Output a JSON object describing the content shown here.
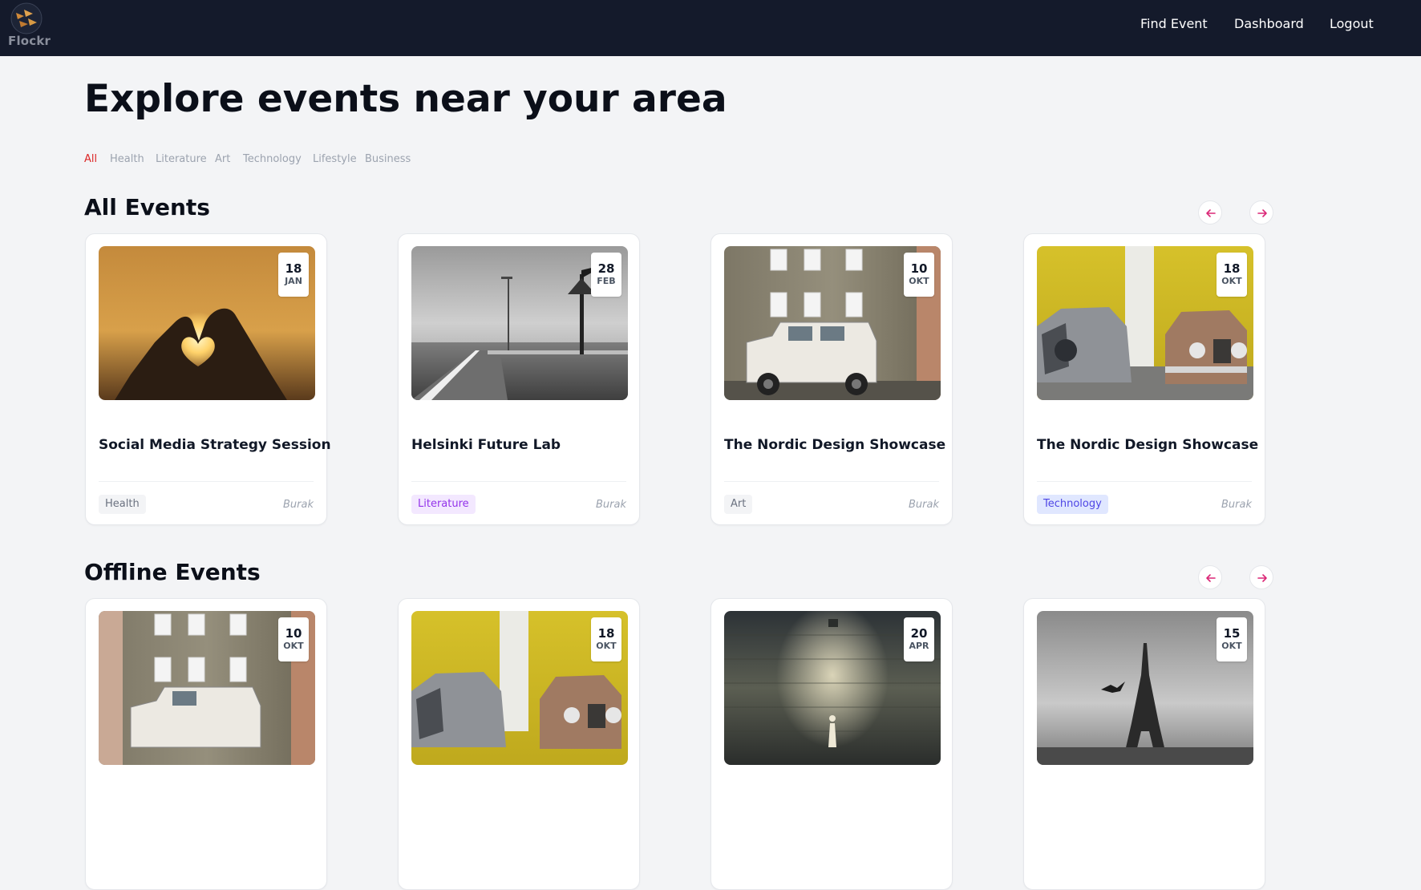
{
  "brand": {
    "name": "Flockr"
  },
  "nav": {
    "find_event": "Find Event",
    "dashboard": "Dashboard",
    "logout": "Logout"
  },
  "page_title": "Explore events near your area",
  "filters": [
    {
      "label": "All",
      "active": true
    },
    {
      "label": "Health"
    },
    {
      "label": "Literature"
    },
    {
      "label": "Art"
    },
    {
      "label": "Technology"
    },
    {
      "label": "Lifestyle"
    },
    {
      "label": "Business"
    }
  ],
  "sections": [
    {
      "title": "All Events",
      "cards": [
        {
          "day": "18",
          "month": "JAN",
          "title": "Social Media Strategy Session",
          "tag": "Health",
          "author": "Burak"
        },
        {
          "day": "28",
          "month": "FEB",
          "title": "Helsinki Future Lab",
          "tag": "Literature",
          "author": "Burak"
        },
        {
          "day": "10",
          "month": "OKT",
          "title": "The Nordic Design Showcase",
          "tag": "Art",
          "author": "Burak"
        },
        {
          "day": "18",
          "month": "OKT",
          "title": "The Nordic Design Showcase",
          "tag": "Technology",
          "author": "Burak"
        }
      ]
    },
    {
      "title": "Offline Events",
      "cards": [
        {
          "day": "10",
          "month": "OKT"
        },
        {
          "day": "18",
          "month": "OKT"
        },
        {
          "day": "20",
          "month": "APR"
        },
        {
          "day": "15",
          "month": "OKT"
        }
      ]
    }
  ],
  "tag_colors": {
    "Health": {
      "bg": "#f3f4f6",
      "fg": "#6b7280"
    },
    "Literature": {
      "bg": "#f3e8ff",
      "fg": "#9333ea"
    },
    "Art": {
      "bg": "#f3f4f6",
      "fg": "#6b7280"
    },
    "Technology": {
      "bg": "#e0e7ff",
      "fg": "#4f46e5"
    }
  },
  "colors": {
    "nav_bg": "#141a2b",
    "page_bg": "#f3f4f6",
    "filter_active": "#dc2626",
    "arrow": "#db2777"
  }
}
